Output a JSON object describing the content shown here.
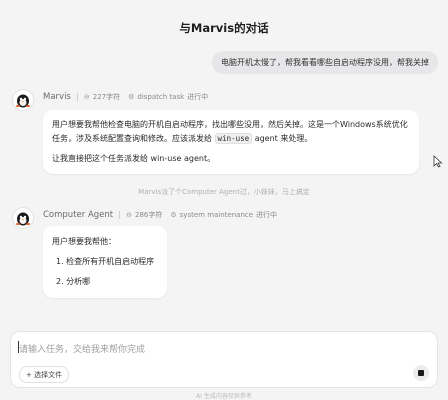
{
  "header": {
    "title": "与Marvis的对话"
  },
  "user_message": {
    "text": "电脑开机太慢了，帮我看看哪些自启动程序没用，帮我关掉"
  },
  "marvis": {
    "name": "Marvis",
    "chars": "227字符",
    "task_label": "dispatch task",
    "status": "进行中",
    "line1": "用户想要我帮他检查电脑的开机自启动程序，找出哪些没用，然后关掉。这是一个Windows系统优化",
    "line2_a": "任务，涉及系统配置查询和修改。应该派发给",
    "line2_code": "win-use",
    "line2_b": "agent 来处理。",
    "line3": "让我直接把这个任务派发给 win-use agent。"
  },
  "dispatch_note": "Marvis派了个Computer Agent过，小妹妹，马上搞定",
  "agent": {
    "name": "Computer Agent",
    "chars": "286字符",
    "task_label": "system maintenance",
    "status": "进行中",
    "intro": "用户想要我帮他：",
    "steps": [
      "1. 检查所有开机自启动程序",
      "2. 分析哪"
    ]
  },
  "input": {
    "placeholder": "请输入任务，交给我来帮你完成",
    "file_button": "+ 选择文件"
  },
  "footer": "AI 生成内容仅供参考"
}
